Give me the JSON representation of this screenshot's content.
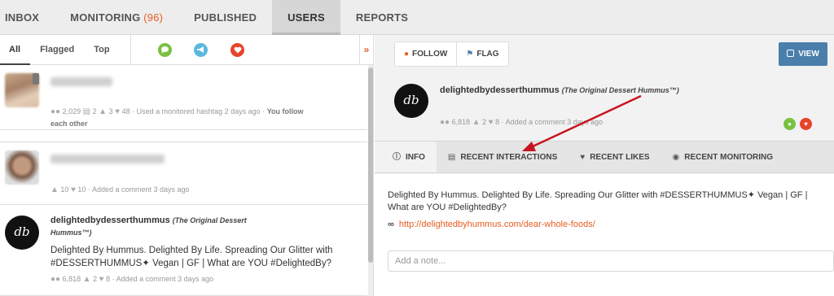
{
  "nav": {
    "tabs": [
      {
        "label": "INBOX"
      },
      {
        "label": "MONITORING",
        "count": "(96)"
      },
      {
        "label": "PUBLISHED"
      },
      {
        "label": "USERS"
      },
      {
        "label": "REPORTS"
      }
    ]
  },
  "filters": {
    "tabs": [
      "All",
      "Flagged",
      "Top"
    ],
    "expand_glyph": "»",
    "icons": [
      {
        "name": "comment",
        "color": "#7ac143"
      },
      {
        "name": "megaphone",
        "color": "#5bb8e0"
      },
      {
        "name": "heart",
        "color": "#e8432c"
      }
    ]
  },
  "users": [
    {
      "followers": "2,029",
      "posts": "2",
      "comments": "3",
      "likes": "48",
      "activity": "Used a monitored hashtag 2 days ago",
      "follow_status": "You follow each other",
      "follow_status_cont": "each other",
      "follow_status_pre": "You follow"
    },
    {
      "comments": "10",
      "likes": "10",
      "activity": "Added a comment 3 days ago"
    },
    {
      "username": "delightedbydesserthummus",
      "fullname_pre": "(The Original Dessert",
      "fullname_post": "Hummus™)",
      "bio_line1": "Delighted By Hummus. Delighted By Life. Spreading Our Glitter with",
      "bio_line2": "#DESSERTHUMMUS✦ Vegan | GF | What are YOU #DelightedBy?",
      "followers": "6,818",
      "comments": "2",
      "likes": "8",
      "activity": "Added a comment 3 days ago"
    }
  ],
  "detail": {
    "buttons": {
      "follow": "FOLLOW",
      "flag": "FLAG",
      "view": "VIEW"
    },
    "username": "delightedbydesserthummus",
    "fullname": "(The Original Dessert Hummus™)",
    "followers": "6,818",
    "comments": "2",
    "likes": "8",
    "activity": "Added a comment 3 days ago",
    "tabs": [
      "INFO",
      "RECENT INTERACTIONS",
      "RECENT LIKES",
      "RECENT MONITORING"
    ],
    "bio_line1": "Delighted By Hummus. Delighted By Life. Spreading Our Glitter with #DESSERTHUMMUS✦ Vegan | GF |",
    "bio_line2": "What are YOU #DelightedBy?",
    "url": "http://delightedbyhummus.com/dear-whole-foods/",
    "note_placeholder": "Add a note..."
  },
  "logo_text": "db",
  "colors": {
    "accent": "#e85c20",
    "view_button": "#4a7fab",
    "green": "#7ac143",
    "red": "#e8432c",
    "arrow": "#c8141e"
  }
}
